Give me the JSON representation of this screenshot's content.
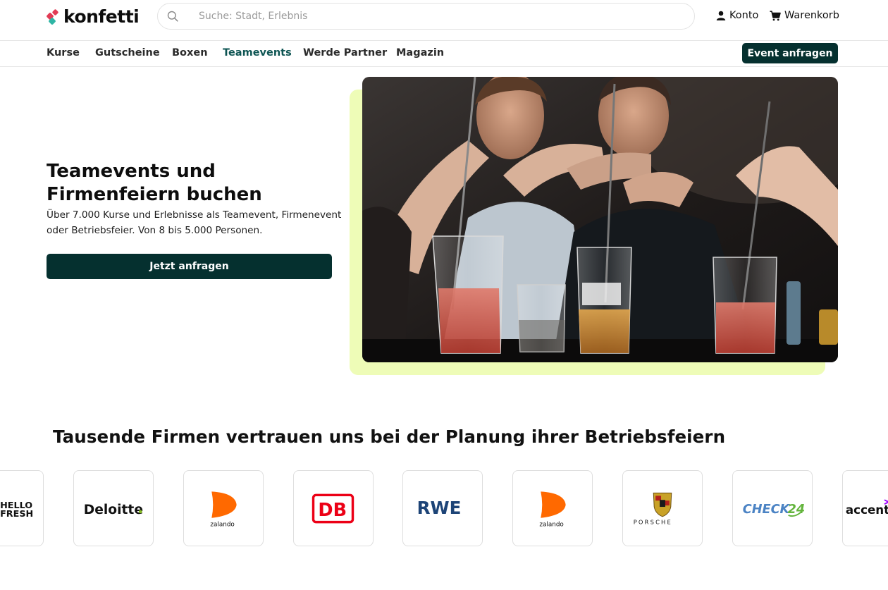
{
  "brand": {
    "name": "konfetti"
  },
  "search": {
    "placeholder": "Suche: Stadt, Erlebnis",
    "icon": "search-icon"
  },
  "header": {
    "account_label": "Konto",
    "cart_label": "Warenkorb"
  },
  "nav": {
    "items": [
      {
        "label": "Kurse",
        "active": false
      },
      {
        "label": "Gutscheine",
        "active": false
      },
      {
        "label": "Boxen",
        "active": false
      },
      {
        "label": "Teamevents",
        "active": true
      },
      {
        "label": "Werde Partner",
        "active": false
      },
      {
        "label": "Magazin",
        "active": false
      }
    ],
    "cta_label": "Event anfragen"
  },
  "hero": {
    "title": "Teamevents und Firmenfeiern buchen",
    "subtitle": "Über 7.000 Kurse und Erlebnisse als Teamevent, Firmenevent oder Betriebsfeier. Von 8 bis 5.000 Personen.",
    "cta_label": "Jetzt anfragen"
  },
  "trust": {
    "title": "Tausende Firmen vertrauen uns bei der Planung ihrer Betriebsfeiern",
    "logos": [
      "HelloFresh",
      "Deloitte",
      "zalando",
      "DB",
      "RWE",
      "zalando",
      "Porsche",
      "CHECK24",
      "accenture"
    ]
  },
  "colors": {
    "primary_dark": "#05302f",
    "nav_active": "#0e5553",
    "hero_accent": "#eefcb7",
    "brand_red": "#e23b55",
    "brand_teal": "#2fb5a5"
  }
}
